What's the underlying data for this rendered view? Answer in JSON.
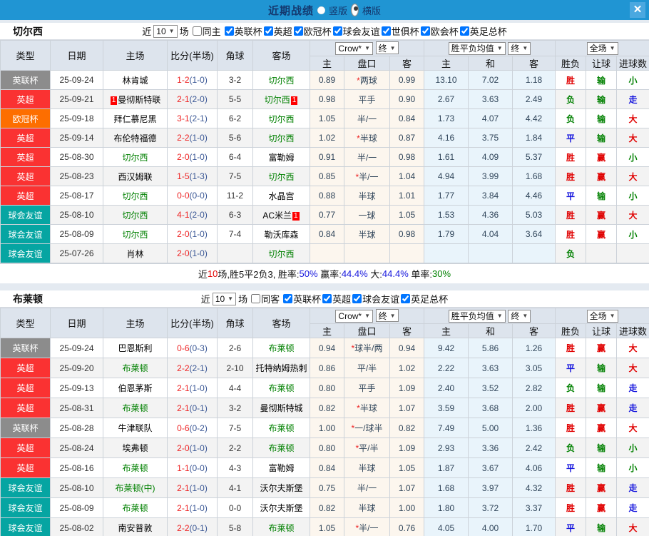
{
  "titlebar": {
    "title": "近期战绩",
    "radios": [
      {
        "label": "竖版",
        "selected": false
      },
      {
        "label": "横版",
        "selected": true
      }
    ],
    "close_label": "✕"
  },
  "selects": {
    "odds_company": "Crow*",
    "odds_time": "终",
    "avg_label": "胜平负均值",
    "avg_time": "终",
    "scope": "全场"
  },
  "table_headers": {
    "col_type": "类型",
    "col_date": "日期",
    "col_home": "主场",
    "col_score": "比分(半场)",
    "col_corner": "角球",
    "col_away": "客场",
    "col_h": "主",
    "col_handicap": "盘口",
    "col_a": "客",
    "col_avg_h": "主",
    "col_avg_d": "和",
    "col_avg_a": "客",
    "col_result": "胜负",
    "col_let": "让球",
    "col_goals": "进球数"
  },
  "type_colors": {
    "英超": "#fa3232",
    "英联杯": "#8c8c8c",
    "欧冠杯": "#fd6e00",
    "球会友谊": "#06a5a2"
  },
  "result_colors": {
    "胜": "#e00000",
    "平": "#1414dd",
    "负": "#008000",
    "赢": "#e00000",
    "输": "#008000",
    "走": "#1414dd",
    "大": "#e00000",
    "小": "#008000"
  },
  "sections": [
    {
      "team": "切尔西",
      "filter": {
        "near": "近",
        "count": "10",
        "games": "场",
        "same": {
          "label": "同主",
          "checked": false
        },
        "leagues": [
          {
            "label": "英联杯",
            "checked": true
          },
          {
            "label": "英超",
            "checked": true
          },
          {
            "label": "欧冠杯",
            "checked": true
          },
          {
            "label": "球会友谊",
            "checked": true
          },
          {
            "label": "世俱杯",
            "checked": true
          },
          {
            "label": "欧会杯",
            "checked": true
          },
          {
            "label": "英足总杯",
            "checked": true
          }
        ]
      },
      "rows": [
        {
          "type": "英联杯",
          "date": "25-09-24",
          "home": {
            "name": "林肯城"
          },
          "ft": "1-2",
          "ht": "(1-0)",
          "corner": "3-2",
          "away": {
            "name": "切尔西",
            "focus": true
          },
          "oh": "0.89",
          "hc": "*两球",
          "oa": "0.99",
          "ah": "13.10",
          "ad": "7.02",
          "aa": "1.18",
          "res": "胜",
          "let": "输",
          "goal": "小"
        },
        {
          "type": "英超",
          "date": "25-09-21",
          "home": {
            "name": "曼彻斯特联",
            "badge_before": "1"
          },
          "ft": "2-1",
          "ht": "(2-0)",
          "corner": "5-5",
          "away": {
            "name": "切尔西",
            "focus": true,
            "badge_after": "1"
          },
          "oh": "0.98",
          "hc": "平手",
          "oa": "0.90",
          "ah": "2.67",
          "ad": "3.63",
          "aa": "2.49",
          "res": "负",
          "let": "输",
          "goal": "走"
        },
        {
          "type": "欧冠杯",
          "date": "25-09-18",
          "home": {
            "name": "拜仁慕尼黑"
          },
          "ft": "3-1",
          "ht": "(2-1)",
          "corner": "6-2",
          "away": {
            "name": "切尔西",
            "focus": true
          },
          "oh": "1.05",
          "hc": "半/一",
          "oa": "0.84",
          "ah": "1.73",
          "ad": "4.07",
          "aa": "4.42",
          "res": "负",
          "let": "输",
          "goal": "大"
        },
        {
          "type": "英超",
          "date": "25-09-14",
          "home": {
            "name": "布伦特福德"
          },
          "ft": "2-2",
          "ht": "(1-0)",
          "corner": "5-6",
          "away": {
            "name": "切尔西",
            "focus": true
          },
          "oh": "1.02",
          "hc": "*半球",
          "oa": "0.87",
          "ah": "4.16",
          "ad": "3.75",
          "aa": "1.84",
          "res": "平",
          "let": "输",
          "goal": "大"
        },
        {
          "type": "英超",
          "date": "25-08-30",
          "home": {
            "name": "切尔西",
            "focus": true
          },
          "ft": "2-0",
          "ht": "(1-0)",
          "corner": "6-4",
          "away": {
            "name": "富勒姆"
          },
          "oh": "0.91",
          "hc": "半/一",
          "oa": "0.98",
          "ah": "1.61",
          "ad": "4.09",
          "aa": "5.37",
          "res": "胜",
          "let": "赢",
          "goal": "小"
        },
        {
          "type": "英超",
          "date": "25-08-23",
          "home": {
            "name": "西汉姆联"
          },
          "ft": "1-5",
          "ht": "(1-3)",
          "corner": "7-5",
          "away": {
            "name": "切尔西",
            "focus": true
          },
          "oh": "0.85",
          "hc": "*半/一",
          "oa": "1.04",
          "ah": "4.94",
          "ad": "3.99",
          "aa": "1.68",
          "res": "胜",
          "let": "赢",
          "goal": "大"
        },
        {
          "type": "英超",
          "date": "25-08-17",
          "home": {
            "name": "切尔西",
            "focus": true
          },
          "ft": "0-0",
          "ht": "(0-0)",
          "corner": "11-2",
          "away": {
            "name": "水晶宫"
          },
          "oh": "0.88",
          "hc": "半球",
          "oa": "1.01",
          "ah": "1.77",
          "ad": "3.84",
          "aa": "4.46",
          "res": "平",
          "let": "输",
          "goal": "小"
        },
        {
          "type": "球会友谊",
          "date": "25-08-10",
          "home": {
            "name": "切尔西",
            "focus": true
          },
          "ft": "4-1",
          "ht": "(2-0)",
          "corner": "6-3",
          "away": {
            "name": "AC米兰",
            "badge_after": "1"
          },
          "oh": "0.77",
          "hc": "一球",
          "oa": "1.05",
          "ah": "1.53",
          "ad": "4.36",
          "aa": "5.03",
          "res": "胜",
          "let": "赢",
          "goal": "大"
        },
        {
          "type": "球会友谊",
          "date": "25-08-09",
          "home": {
            "name": "切尔西",
            "focus": true
          },
          "ft": "2-0",
          "ht": "(1-0)",
          "corner": "7-4",
          "away": {
            "name": "勒沃库森"
          },
          "oh": "0.84",
          "hc": "半球",
          "oa": "0.98",
          "ah": "1.79",
          "ad": "4.04",
          "aa": "3.64",
          "res": "胜",
          "let": "赢",
          "goal": "小"
        },
        {
          "type": "球会友谊",
          "date": "25-07-26",
          "home": {
            "name": "肖林"
          },
          "ft": "2-0",
          "ht": "(1-0)",
          "corner": "",
          "away": {
            "name": "切尔西",
            "focus": true
          },
          "oh": "",
          "hc": "",
          "oa": "",
          "ah": "",
          "ad": "",
          "aa": "",
          "res": "负",
          "let": "",
          "goal": ""
        }
      ],
      "summary": [
        [
          "近",
          "#111111"
        ],
        [
          "10",
          "#e00000"
        ],
        [
          "场,胜5平2负3, 胜率:",
          "#111111"
        ],
        [
          "50%",
          "#1414dd"
        ],
        [
          " 赢率:",
          "#111111"
        ],
        [
          "44.4%",
          "#1414dd"
        ],
        [
          " 大:",
          "#111111"
        ],
        [
          "44.4%",
          "#1414dd"
        ],
        [
          " 单率:",
          "#111111"
        ],
        [
          "30%",
          "#008000"
        ]
      ]
    },
    {
      "team": "布莱顿",
      "filter": {
        "near": "近",
        "count": "10",
        "games": "场",
        "same": {
          "label": "同客",
          "checked": false
        },
        "leagues": [
          {
            "label": "英联杯",
            "checked": true
          },
          {
            "label": "英超",
            "checked": true
          },
          {
            "label": "球会友谊",
            "checked": true
          },
          {
            "label": "英足总杯",
            "checked": true
          }
        ]
      },
      "rows": [
        {
          "type": "英联杯",
          "date": "25-09-24",
          "home": {
            "name": "巴恩斯利"
          },
          "ft": "0-6",
          "ht": "(0-3)",
          "corner": "2-6",
          "away": {
            "name": "布莱顿",
            "focus": true
          },
          "oh": "0.94",
          "hc": "*球半/两",
          "oa": "0.94",
          "ah": "9.42",
          "ad": "5.86",
          "aa": "1.26",
          "res": "胜",
          "let": "赢",
          "goal": "大"
        },
        {
          "type": "英超",
          "date": "25-09-20",
          "home": {
            "name": "布莱顿",
            "focus": true
          },
          "ft": "2-2",
          "ht": "(2-1)",
          "corner": "2-10",
          "away": {
            "name": "托特纳姆热刺"
          },
          "oh": "0.86",
          "hc": "平/半",
          "oa": "1.02",
          "ah": "2.22",
          "ad": "3.63",
          "aa": "3.05",
          "res": "平",
          "let": "输",
          "goal": "大"
        },
        {
          "type": "英超",
          "date": "25-09-13",
          "home": {
            "name": "伯恩茅斯"
          },
          "ft": "2-1",
          "ht": "(1-0)",
          "corner": "4-4",
          "away": {
            "name": "布莱顿",
            "focus": true
          },
          "oh": "0.80",
          "hc": "平手",
          "oa": "1.09",
          "ah": "2.40",
          "ad": "3.52",
          "aa": "2.82",
          "res": "负",
          "let": "输",
          "goal": "走"
        },
        {
          "type": "英超",
          "date": "25-08-31",
          "home": {
            "name": "布莱顿",
            "focus": true
          },
          "ft": "2-1",
          "ht": "(0-1)",
          "corner": "3-2",
          "away": {
            "name": "曼彻斯特城"
          },
          "oh": "0.82",
          "hc": "*半球",
          "oa": "1.07",
          "ah": "3.59",
          "ad": "3.68",
          "aa": "2.00",
          "res": "胜",
          "let": "赢",
          "goal": "走"
        },
        {
          "type": "英联杯",
          "date": "25-08-28",
          "home": {
            "name": "牛津联队"
          },
          "ft": "0-6",
          "ht": "(0-2)",
          "corner": "7-5",
          "away": {
            "name": "布莱顿",
            "focus": true
          },
          "oh": "1.00",
          "hc": "*一/球半",
          "oa": "0.82",
          "ah": "7.49",
          "ad": "5.00",
          "aa": "1.36",
          "res": "胜",
          "let": "赢",
          "goal": "大"
        },
        {
          "type": "英超",
          "date": "25-08-24",
          "home": {
            "name": "埃弗顿"
          },
          "ft": "2-0",
          "ht": "(1-0)",
          "corner": "2-2",
          "away": {
            "name": "布莱顿",
            "focus": true
          },
          "oh": "0.80",
          "hc": "*平/半",
          "oa": "1.09",
          "ah": "2.93",
          "ad": "3.36",
          "aa": "2.42",
          "res": "负",
          "let": "输",
          "goal": "小"
        },
        {
          "type": "英超",
          "date": "25-08-16",
          "home": {
            "name": "布莱顿",
            "focus": true
          },
          "ft": "1-1",
          "ht": "(0-0)",
          "corner": "4-3",
          "away": {
            "name": "富勒姆"
          },
          "oh": "0.84",
          "hc": "半球",
          "oa": "1.05",
          "ah": "1.87",
          "ad": "3.67",
          "aa": "4.06",
          "res": "平",
          "let": "输",
          "goal": "小"
        },
        {
          "type": "球会友谊",
          "date": "25-08-10",
          "home": {
            "name": "布莱顿(中)",
            "focus": true
          },
          "ft": "2-1",
          "ht": "(1-0)",
          "corner": "4-1",
          "away": {
            "name": "沃尔夫斯堡"
          },
          "oh": "0.75",
          "hc": "半/一",
          "oa": "1.07",
          "ah": "1.68",
          "ad": "3.97",
          "aa": "4.32",
          "res": "胜",
          "let": "赢",
          "goal": "走"
        },
        {
          "type": "球会友谊",
          "date": "25-08-09",
          "home": {
            "name": "布莱顿",
            "focus": true
          },
          "ft": "2-1",
          "ht": "(1-0)",
          "corner": "0-0",
          "away": {
            "name": "沃尔夫斯堡"
          },
          "oh": "0.82",
          "hc": "半球",
          "oa": "1.00",
          "ah": "1.80",
          "ad": "3.72",
          "aa": "3.37",
          "res": "胜",
          "let": "赢",
          "goal": "走"
        },
        {
          "type": "球会友谊",
          "date": "25-08-02",
          "home": {
            "name": "南安普敦"
          },
          "ft": "2-2",
          "ht": "(0-1)",
          "corner": "5-8",
          "away": {
            "name": "布莱顿",
            "focus": true
          },
          "oh": "1.05",
          "hc": "*半/一",
          "oa": "0.76",
          "ah": "4.05",
          "ad": "4.00",
          "aa": "1.70",
          "res": "平",
          "let": "输",
          "goal": "大"
        }
      ],
      "summary": null
    }
  ]
}
